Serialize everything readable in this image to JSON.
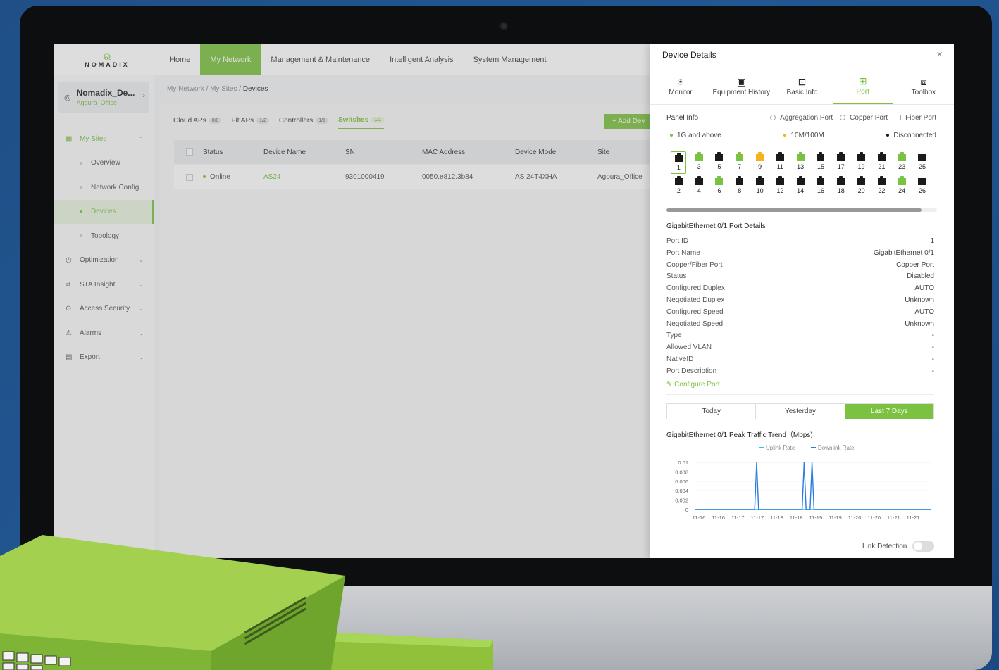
{
  "brand": {
    "name": "NOMADIX",
    "accent": "#7cc242"
  },
  "topnav": {
    "items": [
      "Home",
      "My Network",
      "Management & Maintenance",
      "Intelligent Analysis",
      "System Management"
    ],
    "active": "My Network"
  },
  "site": {
    "name": "Nomadix_De...",
    "sub": "Agoura_Office"
  },
  "sidebar": {
    "items": [
      {
        "label": "My Sites",
        "icon": "building-icon"
      },
      {
        "label": "Overview"
      },
      {
        "label": "Network Config"
      },
      {
        "label": "Devices"
      },
      {
        "label": "Topology"
      },
      {
        "label": "Optimization",
        "icon": "gauge-icon"
      },
      {
        "label": "STA Insight",
        "icon": "insight-icon"
      },
      {
        "label": "Access Security",
        "icon": "security-icon"
      },
      {
        "label": "Alarms",
        "icon": "alarm-icon"
      },
      {
        "label": "Export",
        "icon": "export-icon"
      }
    ]
  },
  "breadcrumb": {
    "a": "My Network",
    "b": "My Sites",
    "c": "Devices",
    "sep": "/"
  },
  "device_tabs": [
    {
      "label": "Cloud APs",
      "count": "0/0"
    },
    {
      "label": "Fit APs",
      "count": "1/2"
    },
    {
      "label": "Controllers",
      "count": "1/1"
    },
    {
      "label": "Switches",
      "count": "1/1"
    }
  ],
  "add_button": "+ Add Dev",
  "table": {
    "headers": [
      "Status",
      "Device Name",
      "SN",
      "MAC Address",
      "Device Model",
      "Site"
    ],
    "row": [
      "Online",
      "AS24",
      "9301000419",
      "0050.e812.3b84",
      "AS 24T4XHA",
      "Agoura_Office"
    ]
  },
  "panel": {
    "title": "Device Details",
    "close": "×",
    "tabs": [
      "Monitor",
      "Equipment History",
      "Basic Info",
      "Port",
      "Toolbox"
    ],
    "panel_info": "Panel Info",
    "legend": {
      "aggregation": "Aggregation Port",
      "copper": "Copper Port",
      "fiber": "Fiber Port"
    },
    "status_legend": {
      "g1": "1G and above",
      "m100": "10M/100M",
      "disc": "Disconnected"
    },
    "status_colors": {
      "g1": "#7cc242",
      "m100": "#f5b21d",
      "disc": "#1a1a1a"
    },
    "ports_top": [
      {
        "n": "1",
        "s": "disc",
        "sel": true
      },
      {
        "n": "3",
        "s": "g1"
      },
      {
        "n": "5",
        "s": "disc"
      },
      {
        "n": "7",
        "s": "g1"
      },
      {
        "n": "9",
        "s": "m100"
      },
      {
        "n": "11",
        "s": "disc"
      },
      {
        "n": "13",
        "s": "g1"
      },
      {
        "n": "15",
        "s": "disc"
      },
      {
        "n": "17",
        "s": "disc"
      },
      {
        "n": "19",
        "s": "disc"
      },
      {
        "n": "21",
        "s": "disc"
      },
      {
        "n": "23",
        "s": "g1"
      },
      {
        "n": "25",
        "s": "disc",
        "fiber": true
      }
    ],
    "ports_bottom": [
      {
        "n": "2",
        "s": "disc"
      },
      {
        "n": "4",
        "s": "disc"
      },
      {
        "n": "6",
        "s": "g1"
      },
      {
        "n": "8",
        "s": "disc"
      },
      {
        "n": "10",
        "s": "disc"
      },
      {
        "n": "12",
        "s": "disc"
      },
      {
        "n": "14",
        "s": "disc"
      },
      {
        "n": "16",
        "s": "disc"
      },
      {
        "n": "18",
        "s": "disc"
      },
      {
        "n": "20",
        "s": "disc"
      },
      {
        "n": "22",
        "s": "disc"
      },
      {
        "n": "24",
        "s": "g1"
      },
      {
        "n": "26",
        "s": "disc",
        "fiber": true
      }
    ],
    "details_title": "GigabitEthernet 0/1 Port Details",
    "details": [
      [
        "Port ID",
        "1"
      ],
      [
        "Port Name",
        "GigabitEthernet 0/1"
      ],
      [
        "Copper/Fiber Port",
        "Copper Port"
      ],
      [
        "Status",
        "Disabled"
      ],
      [
        "Configured Duplex",
        "AUTO"
      ],
      [
        "Negotiated Duplex",
        "Unknown"
      ],
      [
        "Configured Speed",
        "AUTO"
      ],
      [
        "Negotiated Speed",
        "Unknown"
      ],
      [
        "Type",
        "-"
      ],
      [
        "Allowed VLAN",
        "-"
      ],
      [
        "NativeID",
        "-"
      ],
      [
        "Port Description",
        "-"
      ]
    ],
    "configure_port": "Configure Port",
    "ranges": [
      "Today",
      "Yesterday",
      "Last 7 Days"
    ],
    "trend_title": "GigabitEthernet 0/1 Peak Traffic Trend（Mbps)",
    "link_detection": "Link Detection"
  },
  "chart_data": {
    "type": "line",
    "title": "GigabitEthernet 0/1 Peak Traffic Trend（Mbps)",
    "xlabel": "",
    "ylabel": "",
    "x_ticks": [
      "11-16",
      "11-16",
      "11-17",
      "11-17",
      "11-18",
      "11-18",
      "11-19",
      "11-19",
      "11-20",
      "11-20",
      "11-21",
      "11-21"
    ],
    "y_ticks": [
      "0.01",
      "0.008",
      "0.006",
      "0.004",
      "0.002",
      "0"
    ],
    "ylim": [
      0,
      0.01
    ],
    "x_count": 120,
    "series": [
      {
        "name": "Uplink Rate",
        "color": "#2ec4d6",
        "spikes": []
      },
      {
        "name": "Downlink Rate",
        "color": "#2a7de1",
        "spikes": [
          [
            31,
            0.01
          ],
          [
            55,
            0.01
          ],
          [
            59,
            0.01
          ]
        ]
      }
    ],
    "legend": "top"
  }
}
